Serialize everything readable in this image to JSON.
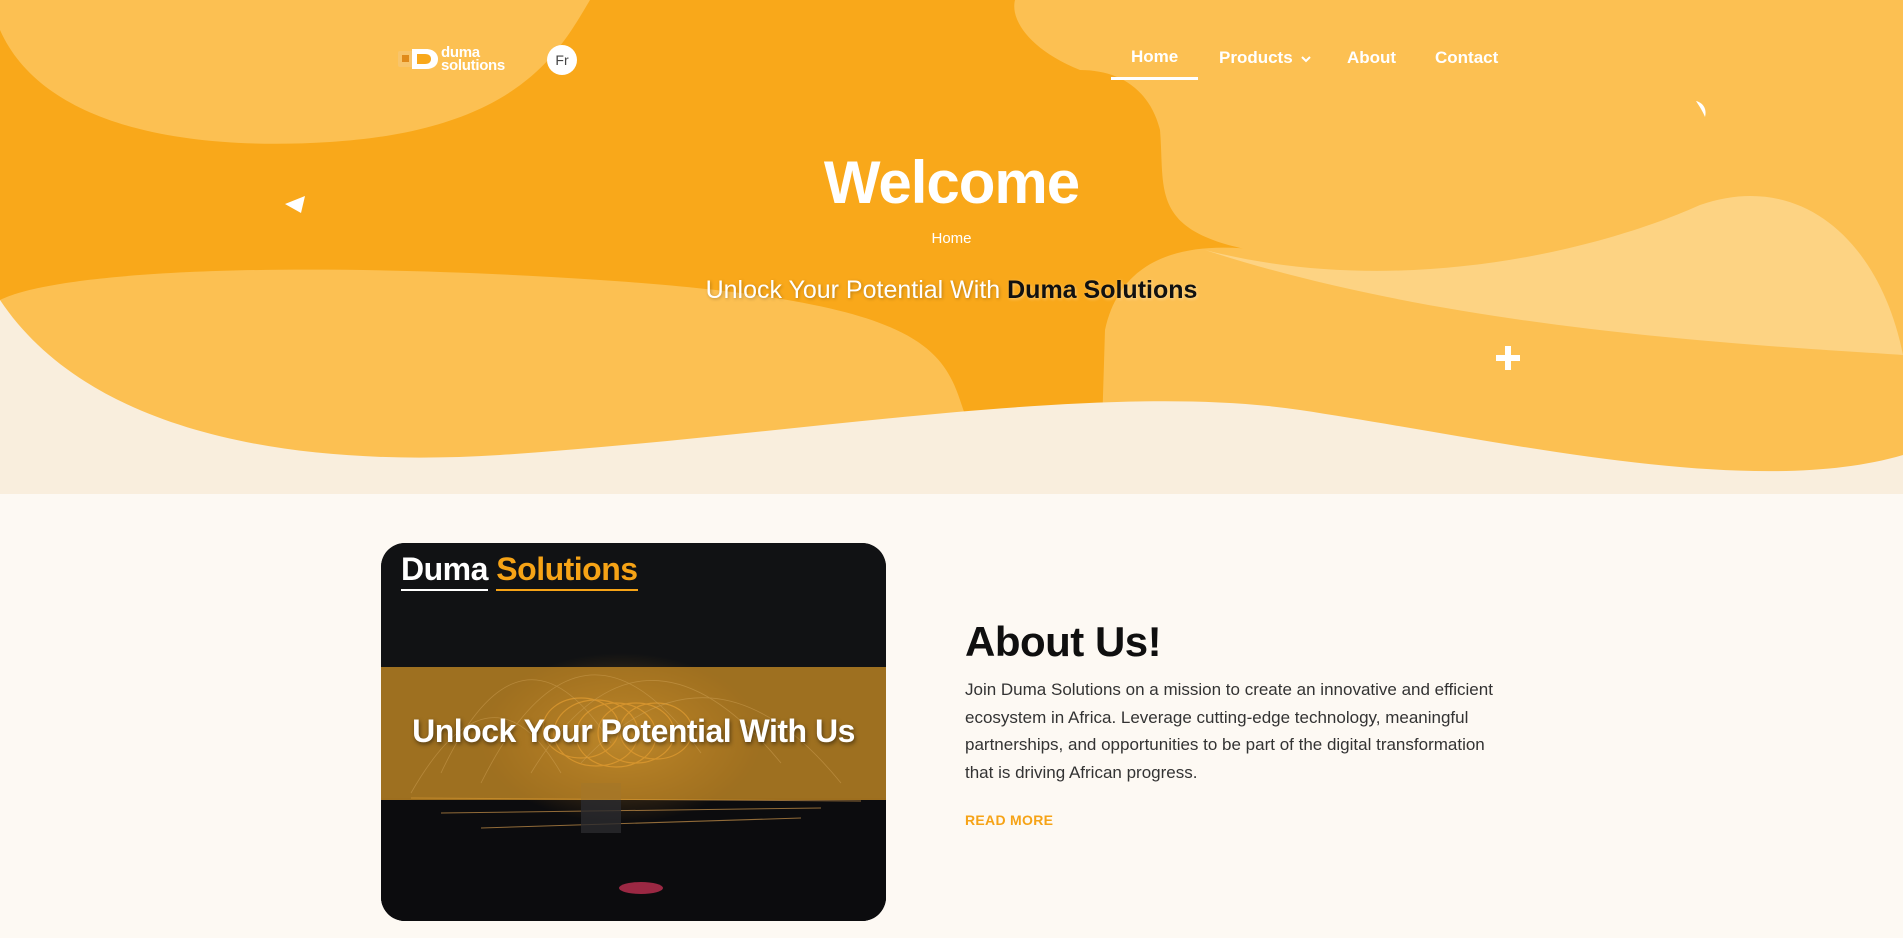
{
  "colors": {
    "accent": "#f6a316",
    "hero_dark": "#f9a81a",
    "hero_mid": "#fcc052",
    "hero_light": "#fdd383",
    "page_bg": "#fdf9f3",
    "hero_bg": "#f9eedd"
  },
  "header": {
    "logo_line1": "duma",
    "logo_line2": "solutions",
    "lang_label": "Fr",
    "nav": [
      {
        "label": "Home",
        "active": true
      },
      {
        "label": "Products",
        "has_dropdown": true
      },
      {
        "label": "About"
      },
      {
        "label": "Contact"
      }
    ]
  },
  "hero": {
    "title": "Welcome",
    "breadcrumb": "Home",
    "tagline_prefix": "Unlock Your Potential With",
    "tagline_brand": "Duma Solutions"
  },
  "about": {
    "card_brand_1": "Duma",
    "card_brand_2": "Solutions",
    "card_tagline": "Unlock Your Potential With Us",
    "title": "About Us!",
    "body": "Join Duma Solutions on a mission to create an innovative and efficient ecosystem in Africa. Leverage cutting-edge technology, meaningful partnerships, and opportunities to be part of the digital transformation that is driving African progress.",
    "read_more": "READ MORE"
  },
  "icons": {
    "chevron": "chevron-down-icon",
    "plus": "plus-decoration-icon",
    "triangle": "triangle-decoration-icon"
  }
}
